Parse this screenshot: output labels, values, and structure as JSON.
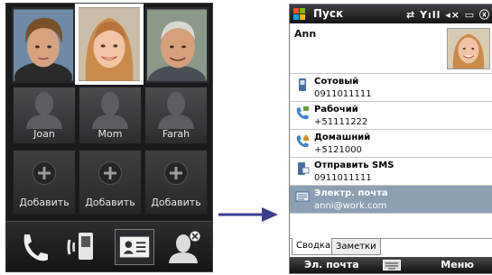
{
  "left_screen": {
    "favorites": [
      {
        "name": "Joan",
        "photo": "young-man-photo"
      },
      {
        "name": "Mom",
        "photo": "woman-photo",
        "selected": true
      },
      {
        "name": "Farah",
        "photo": "older-man-photo"
      }
    ],
    "add_slots": [
      "Добавить",
      "Добавить",
      "Добавить"
    ],
    "bottom_buttons": [
      "phone-icon",
      "call-history-icon",
      "contact-card-icon",
      "remove-contact-icon"
    ]
  },
  "arrow_color": "#3b3f8f",
  "right_screen": {
    "title": "Пуск",
    "status_icons": [
      "signal-icon",
      "volume-icon",
      "battery-icon",
      "close-icon"
    ],
    "status_text": "⇄ Yıll ◂× ▭ ⓧ",
    "contact_name": "Ann",
    "entries": [
      {
        "label": "Сотовый",
        "value": "0911011111",
        "icon": "mobile-phone-icon"
      },
      {
        "label": "Рабочий",
        "value": "+51111222",
        "icon": "work-phone-icon"
      },
      {
        "label": "Домашний",
        "value": "+5121000",
        "icon": "home-phone-icon"
      },
      {
        "label": "Отправить SMS",
        "value": "0911011111",
        "icon": "sms-icon"
      },
      {
        "label": "Электр. почта",
        "value": "anni@work.com",
        "icon": "email-icon",
        "selected": true
      }
    ],
    "tabs": [
      "Сводка",
      "Заметки"
    ],
    "softkeys": {
      "left": "Эл. почта",
      "right": "Меню"
    },
    "highlight_color": "#8d9fb3"
  }
}
